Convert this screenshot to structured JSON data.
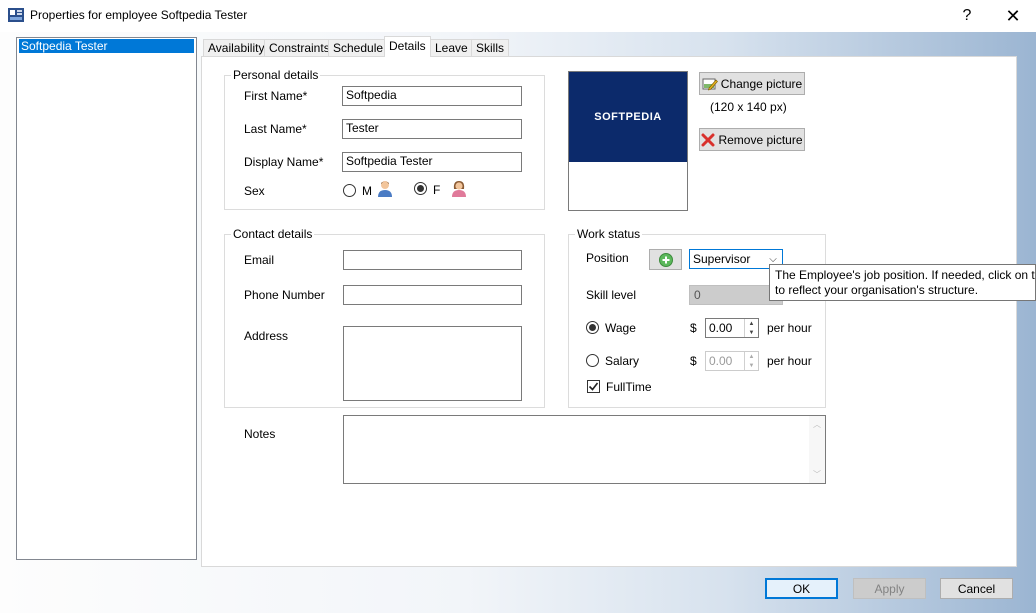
{
  "window": {
    "title": "Properties for employee Softpedia Tester",
    "help": "?",
    "close": "✕"
  },
  "employees": [
    "Softpedia Tester"
  ],
  "tabs": [
    {
      "label": "Availability"
    },
    {
      "label": "Constraints"
    },
    {
      "label": "Schedule"
    },
    {
      "label": "Details"
    },
    {
      "label": "Leave"
    },
    {
      "label": "Skills"
    }
  ],
  "active_tab": "Details",
  "personal": {
    "group_title": "Personal details",
    "first_name_label": "First Name*",
    "first_name": "Softpedia",
    "last_name_label": "Last Name*",
    "last_name": "Tester",
    "display_name_label": "Display Name*",
    "display_name": "Softpedia Tester",
    "sex_label": "Sex",
    "sex_m": "M",
    "sex_f": "F",
    "sex_selected": "F"
  },
  "picture": {
    "logo_text": "SOFTPEDIA",
    "change_label": "Change picture",
    "size_hint": "(120 x 140 px)",
    "remove_label": "Remove picture"
  },
  "contact": {
    "group_title": "Contact details",
    "email_label": "Email",
    "email": "",
    "phone_label": "Phone Number",
    "phone": "",
    "address_label": "Address",
    "address": ""
  },
  "work": {
    "group_title": "Work status",
    "position_label": "Position",
    "position": "Supervisor",
    "tooltip_line1": "The Employee's job position.  If needed, click on t",
    "tooltip_line2": "to reflect your organisation's structure.",
    "skill_label": "Skill level",
    "skill_value": "0",
    "wage_label": "Wage",
    "wage_currency": "$",
    "wage_value": "0.00",
    "wage_unit": "per hour",
    "salary_label": "Salary",
    "salary_currency": "$",
    "salary_value": "0.00",
    "salary_unit": "per hour",
    "pay_selected": "Wage",
    "fulltime_label": "FullTime",
    "fulltime_checked": true
  },
  "notes": {
    "label": "Notes",
    "value": ""
  },
  "buttons": {
    "ok": "OK",
    "apply": "Apply",
    "cancel": "Cancel"
  },
  "colors": {
    "accent": "#0078d7",
    "logo_bg": "#0c2a6b",
    "add_green": "#5cb85c",
    "remove_red": "#d9302c"
  }
}
